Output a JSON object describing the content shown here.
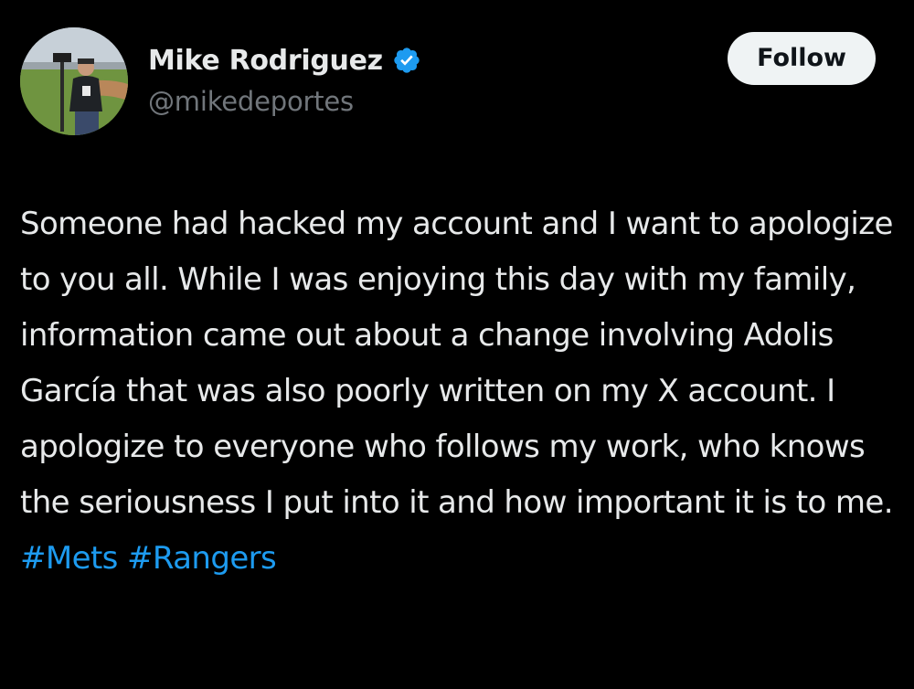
{
  "post": {
    "author": {
      "display_name": "Mike Rodriguez",
      "handle": "@mikedeportes",
      "verified": true,
      "verified_color": "#1d9bf0"
    },
    "follow_label": "Follow",
    "text_main": "Someone had hacked my account and I want to apologize to you all. While I was enjoying this day with my family, information came out about a change involving Adolis García that was also poorly written on my X account. I apologize to everyone who follows my work, who knows the seriousness I put into it and how important it is to me.",
    "hashtags": [
      "#Mets",
      "#Rangers"
    ]
  },
  "theme": {
    "background": "#000000",
    "text": "#e7e9ea",
    "secondary_text": "#71767b",
    "link": "#1d9bf0"
  },
  "icons": {
    "verified": "verified-badge-icon",
    "avatar": "avatar"
  }
}
